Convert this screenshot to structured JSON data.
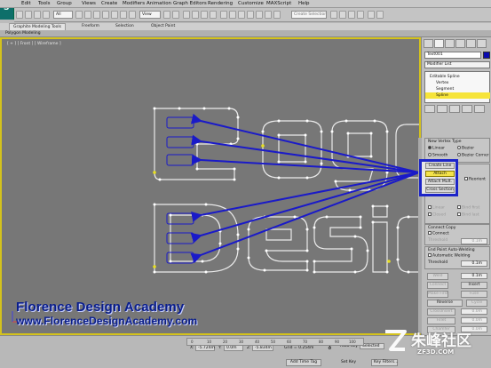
{
  "app": {
    "logo_glyph": "S"
  },
  "menu": [
    "Edit",
    "Tools",
    "Group",
    "Views",
    "Create",
    "Modifiers",
    "Animation",
    "Graph Editors",
    "Rendering",
    "Customize",
    "MAXScript",
    "Help"
  ],
  "toolbar": {
    "filter_dropdown": "All",
    "view_dropdown": "View",
    "selection_set_dropdown": "Create Selection Se"
  },
  "ribbon": {
    "tabs": [
      "Graphite Modeling Tools",
      "Freeform",
      "Selection",
      "Object Paint"
    ],
    "subtab": "Polygon Modeling"
  },
  "viewport": {
    "label": "[ + ] [ Front ] [ Wireframe ]",
    "scene_text_line1": "Logo",
    "scene_text_line2": "Design",
    "wire_color": "#ebebeb",
    "vertex_color": "#ffffff",
    "arrow_color": "#1a1ac8",
    "highlight_color": "#d4c21c"
  },
  "academy": {
    "name": "Florence Design Academy",
    "url": "www.FlorenceDesignAcademy.com",
    "color": "#0a1e8c"
  },
  "command_panel": {
    "object_name": "Text001",
    "object_color": "#0a0ab0",
    "modifier_list": "Modifier List",
    "stack": [
      "Editable Spline",
      "Vertex",
      "Segment",
      "Spline"
    ],
    "stack_selected": "Spline",
    "new_vertex_type": {
      "title": "New Vertex Type",
      "options": [
        "Linear",
        "Bezier",
        "Smooth",
        "Bezier Corner"
      ],
      "selected": "Linear"
    },
    "geometry_buttons": [
      "Create Line",
      "Attach",
      "Attach Mult.",
      "Cross Section"
    ],
    "geometry_active": "Attach",
    "reorient_label": "Reorient",
    "dim_checks": [
      "Linear",
      "Bind first",
      "Closed",
      "Bind last"
    ],
    "connect_copy": {
      "title": "Connect Copy",
      "connect": "Connect",
      "threshold_label": "Threshold",
      "threshold_value": "0.1m"
    },
    "end_point": {
      "title": "End Point Auto-Welding",
      "auto": "Automatic Welding",
      "threshold_label": "Threshold",
      "threshold_value": "0.1m"
    },
    "weld_value": "0.1m",
    "buttons": [
      "Weld",
      "Connect",
      "Insert",
      "Make First",
      "Fuse",
      "Reverse",
      "Cycle",
      "CrossInsert",
      "Fillet",
      "Chamfer"
    ],
    "field_values": [
      "0.1m",
      "0.0m",
      "0.0m",
      "0.0m"
    ]
  },
  "status": {
    "x_label": "X:",
    "x_value": "-5.724m",
    "y_label": "Y:",
    "y_value": "0.0m",
    "z_label": "Z:",
    "z_value": "-5.834m",
    "grid_label": "Grid = 0.254m",
    "auto_key": "Auto Key",
    "set_key": "Set Key",
    "selected_dropdown": "Selected",
    "key_filters": "Key Filters...",
    "add_time_tag": "Add Time Tag",
    "timeline_ticks": [
      "0",
      "10",
      "20",
      "30",
      "40",
      "50",
      "60",
      "70",
      "80",
      "90",
      "100"
    ]
  },
  "watermark": {
    "text": "朱峰社区",
    "sub": "ZF3D.COM"
  }
}
